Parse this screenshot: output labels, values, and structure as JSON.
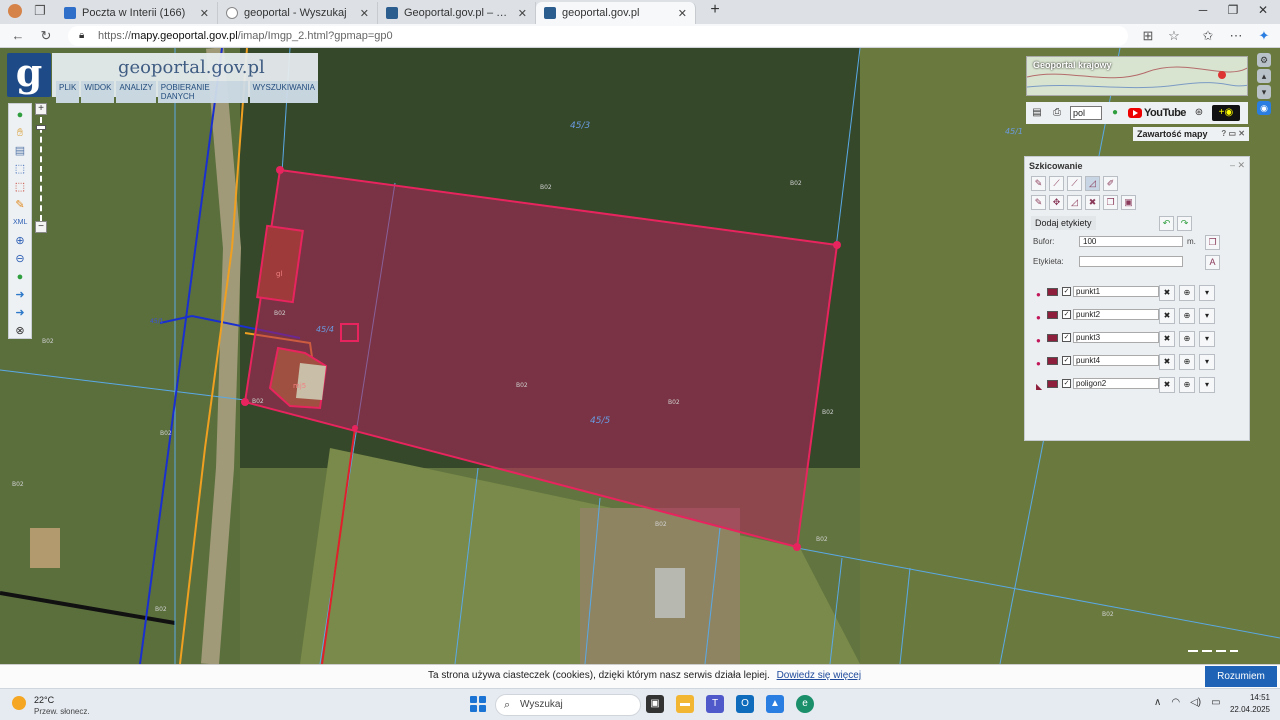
{
  "browser": {
    "tabs": [
      {
        "title": "Poczta w Interii (166)",
        "color": "#2f6fc9"
      },
      {
        "title": "geoportal - Wyszukaj",
        "color": "#888888"
      },
      {
        "title": "Geoportal.gov.pl – Geoportal Infra",
        "color": "#2c5d8f"
      },
      {
        "title": "geoportal.gov.pl",
        "color": "#2c5d8f"
      }
    ],
    "new_tab": "+",
    "url_prefix": "https://",
    "url_host": "mapy.geoportal.gov.pl",
    "url_path": "/imap/Imgp_2.html?gpmap=gp0"
  },
  "geoportal": {
    "logo_letter": "g",
    "title": "geoportal.gov.pl",
    "menu": [
      "PLIK",
      "WIDOK",
      "ANALIZY",
      "POBIERANIE DANYCH",
      "WYSZUKIWANIA"
    ],
    "minimap_label": "Geoportal krajowy",
    "lang": "pol",
    "youtube": "YouTube",
    "map_content_title": "Zawartość mapy"
  },
  "map_labels": {
    "parcel_main": "45/5",
    "parcel_top": "45/3",
    "parcel_small": "45/4",
    "parcel_right": "45/1",
    "building1": "gl",
    "building2": "mj5",
    "area_codes": [
      "B02",
      "B02",
      "B02",
      "B02",
      "B02",
      "B02",
      "B02",
      "B02",
      "B02",
      "B02",
      "B02",
      "B02",
      "B02",
      "B02"
    ],
    "road_number": "45/1"
  },
  "sketch": {
    "title": "Szkicowanie",
    "add_labels": "Dodaj etykiety",
    "buffer_label": "Bufor:",
    "buffer_value": "100",
    "buffer_unit": "m.",
    "label_label": "Etykieta:",
    "label_value": "",
    "features": [
      "punkt1",
      "punkt2",
      "punkt3",
      "punkt4",
      "poligon2"
    ]
  },
  "cookie": {
    "text": "Ta strona używa ciasteczek (cookies), dzięki którym nasz serwis działa lepiej.",
    "link": "Dowiedz się więcej",
    "button": "Rozumiem"
  },
  "taskbar": {
    "temp": "22°C",
    "weather": "Przew. słonecz.",
    "search_placeholder": "Wyszukaj",
    "time": "14:51",
    "date": "22.04.2025"
  },
  "colors": {
    "accent": "#1e63b5",
    "sketch_polygon": "#c2185b",
    "parcel_lines": "#5aa9e6"
  }
}
